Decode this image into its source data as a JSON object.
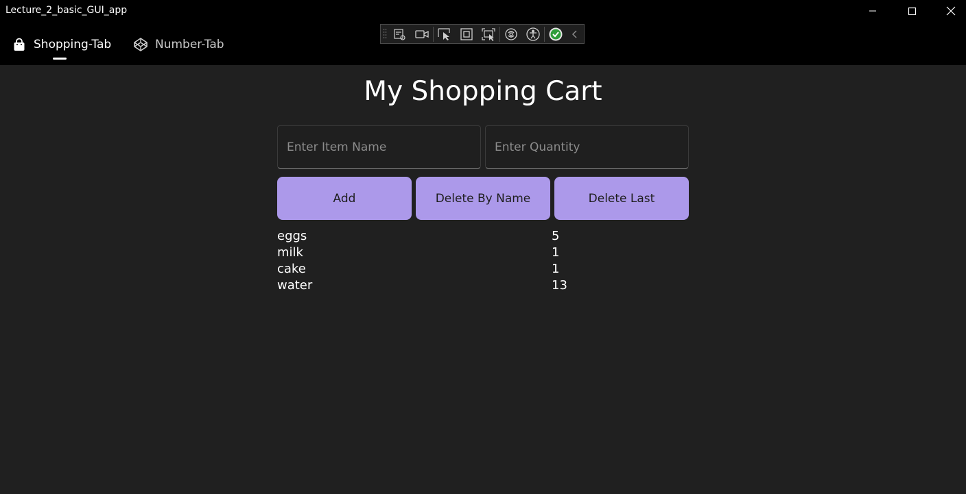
{
  "window": {
    "title": "Lecture_2_basic_GUI_app"
  },
  "tabs": [
    {
      "label": "Shopping-Tab",
      "icon": "shopping-bag-icon",
      "active": true
    },
    {
      "label": "Number-Tab",
      "icon": "codepen-icon",
      "active": false
    }
  ],
  "debug_toolbar": {
    "icons": [
      "grip-icon",
      "live-visual-tree-icon",
      "video-camera-icon",
      "select-element-icon",
      "display-layout-adorners-icon",
      "track-focus-icon",
      "hot-reload-icon",
      "accessibility-icon",
      "status-ok-icon",
      "collapse-chevron-icon"
    ]
  },
  "main": {
    "title": "My Shopping Cart",
    "item_name_placeholder": "Enter Item Name",
    "quantity_placeholder": "Enter Quantity",
    "buttons": {
      "add": "Add",
      "delete_by_name": "Delete By Name",
      "delete_last": "Delete Last"
    },
    "items": [
      {
        "name": "eggs",
        "qty": "5"
      },
      {
        "name": "milk",
        "qty": "1"
      },
      {
        "name": "cake",
        "qty": "1"
      },
      {
        "name": "water",
        "qty": "13"
      }
    ]
  },
  "colors": {
    "background": "#202020",
    "chrome": "#000000",
    "button_accent": "#ac99ea",
    "button_text": "#1e1e1e"
  }
}
